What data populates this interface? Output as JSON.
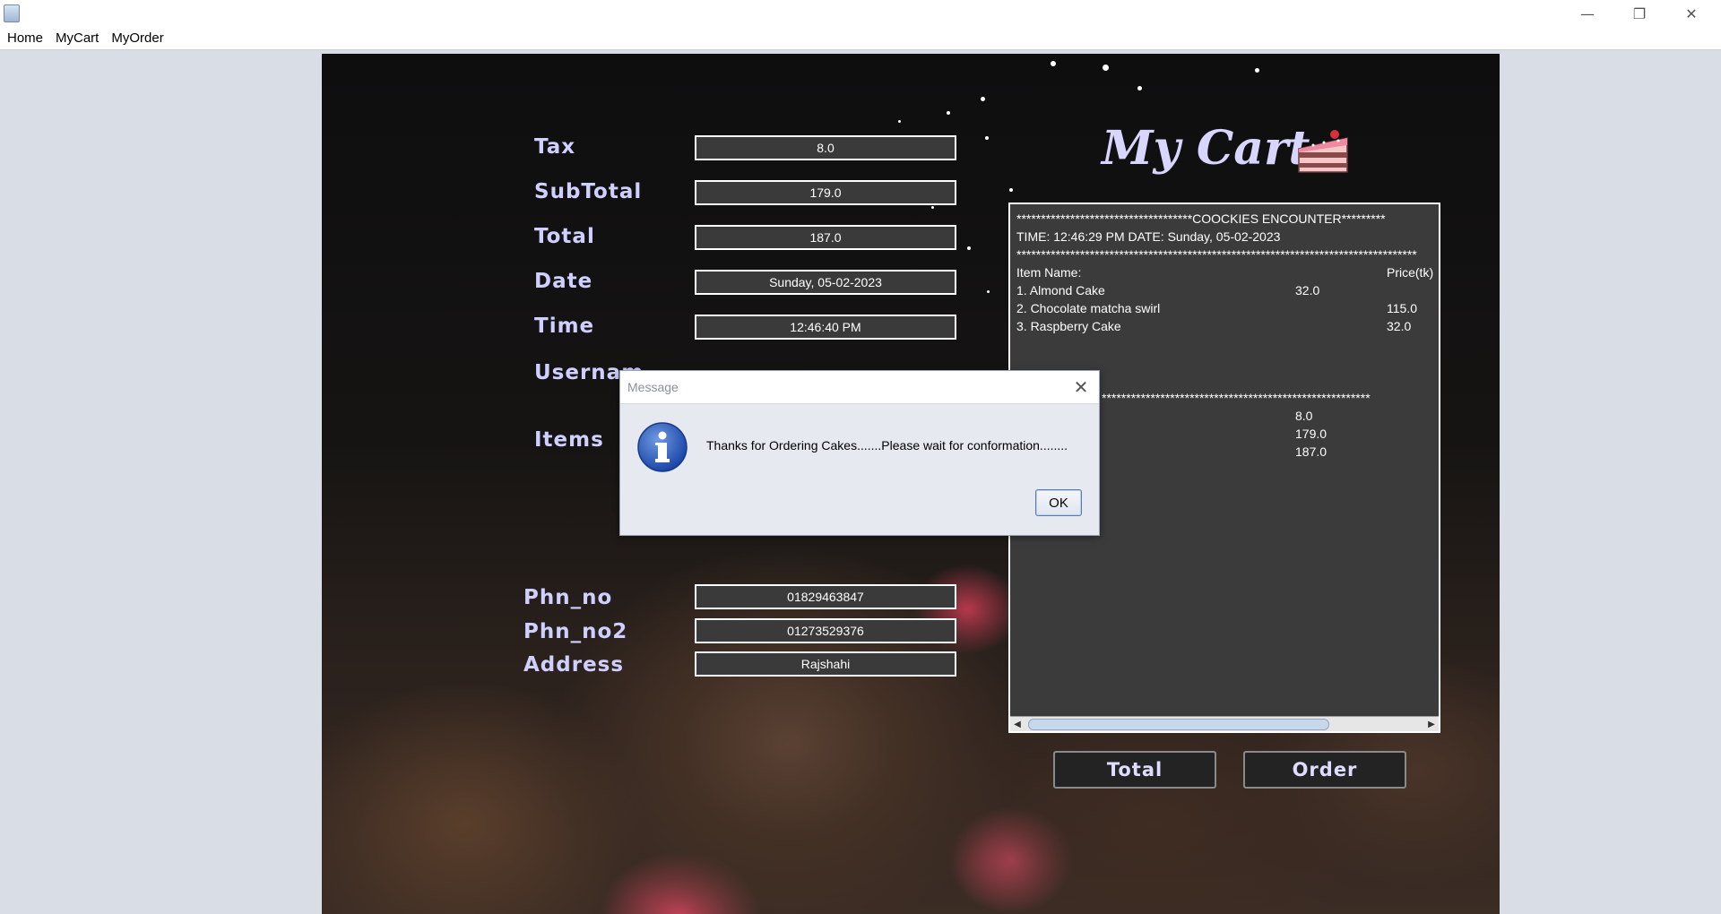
{
  "window": {
    "app_icon": "java-cup-icon"
  },
  "menu": {
    "items": [
      "Home",
      "MyCart",
      "MyOrder"
    ]
  },
  "cart": {
    "title": "My Cart",
    "fields": {
      "tax": {
        "label": "Tax",
        "value": "8.0"
      },
      "subtotal": {
        "label": "SubTotal",
        "value": "179.0"
      },
      "total": {
        "label": "Total",
        "value": "187.0"
      },
      "date": {
        "label": "Date",
        "value": "Sunday, 05-02-2023"
      },
      "time": {
        "label": "Time",
        "value": "12:46:40 PM"
      },
      "username": {
        "label": "Usernam"
      },
      "items": {
        "label": "Items"
      },
      "phone": {
        "label": "Phn_no",
        "value": "01829463847"
      },
      "phone2": {
        "label": "Phn_no2",
        "value": "01273529376"
      },
      "address": {
        "label": "Address",
        "value": "Rajshahi"
      }
    },
    "buttons": {
      "total": "Total",
      "order": "Order"
    }
  },
  "receipt": {
    "header": "************************************COOCKIES ENCOUNTER*********",
    "timestamp": "TIME: 12:46:29 PM DATE: Sunday, 05-02-2023",
    "divider": "**********************************************************************************",
    "item_name_header": "Item Name:",
    "price_header": "Price(tk)",
    "items": [
      {
        "name": "1. Almond Cake",
        "price": "32.0"
      },
      {
        "name": "2. Chocolate matcha swirl",
        "price": "115.0"
      },
      {
        "name": "3. Raspberry Cake",
        "price": "32.0"
      }
    ],
    "divider2": "*******************************************************",
    "tax": "8.0",
    "subtotal": "179.0",
    "total": "187.0"
  },
  "dialog": {
    "title": "Message",
    "message": "Thanks for Ordering Cakes.......Please wait for conformation........",
    "ok_label": "OK",
    "icon": "information-icon"
  }
}
